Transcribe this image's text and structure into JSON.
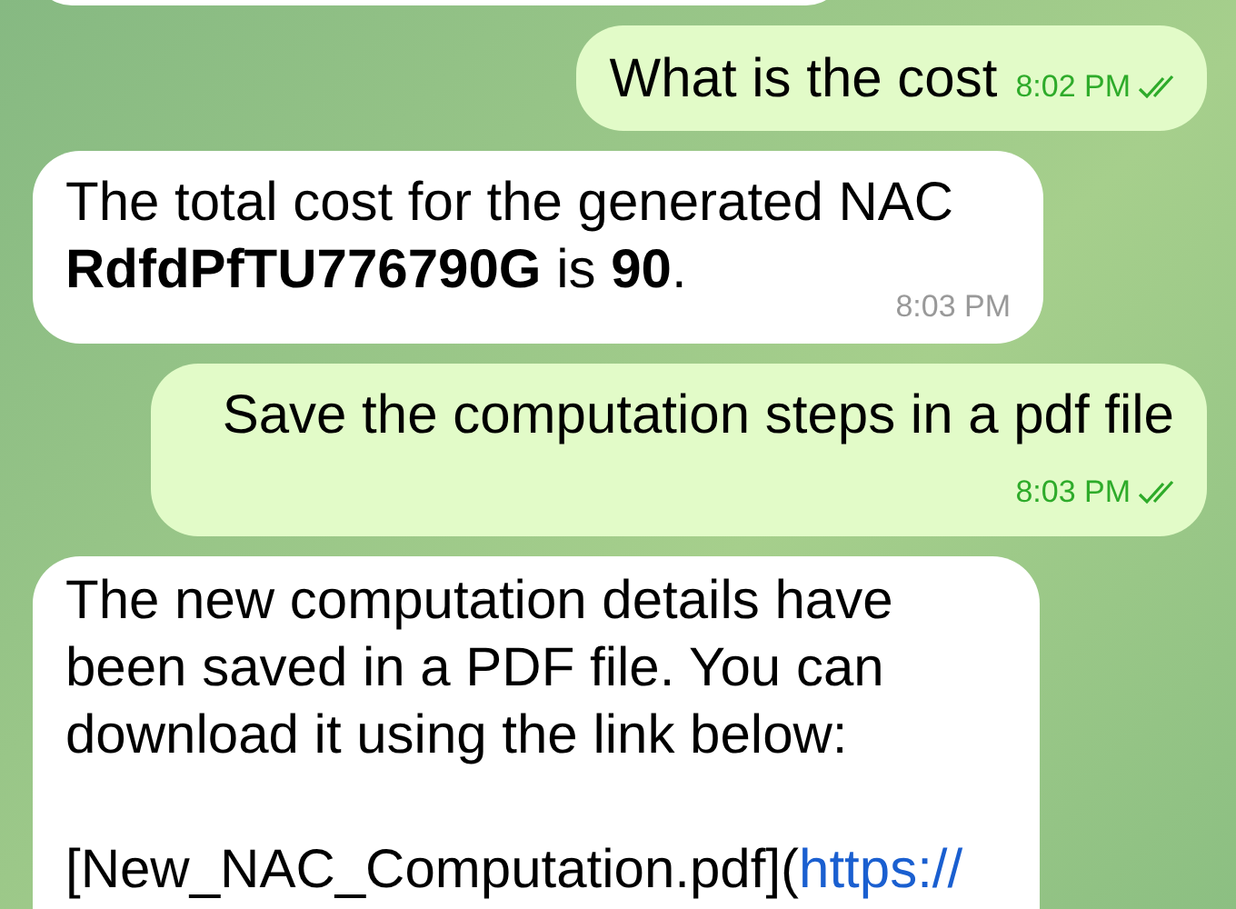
{
  "messages": [
    {
      "kind": "incoming"
    },
    {
      "kind": "outgoing",
      "text": "What is the cost",
      "time": "8:02 PM",
      "read": true
    },
    {
      "kind": "incoming",
      "text": "The total cost for the generated NAC **RdfdPfTU776790G** is **90**.",
      "time": "8:03 PM"
    },
    {
      "kind": "outgoing",
      "text": "Save the computation steps in a pdf file",
      "time": "8:03 PM",
      "read": true
    },
    {
      "kind": "incoming",
      "text": "The new computation details have been saved in a PDF file. You can download it using the link below:",
      "link_prefix": "[New_NAC_Computation.pdf](",
      "link": "https://"
    }
  ]
}
